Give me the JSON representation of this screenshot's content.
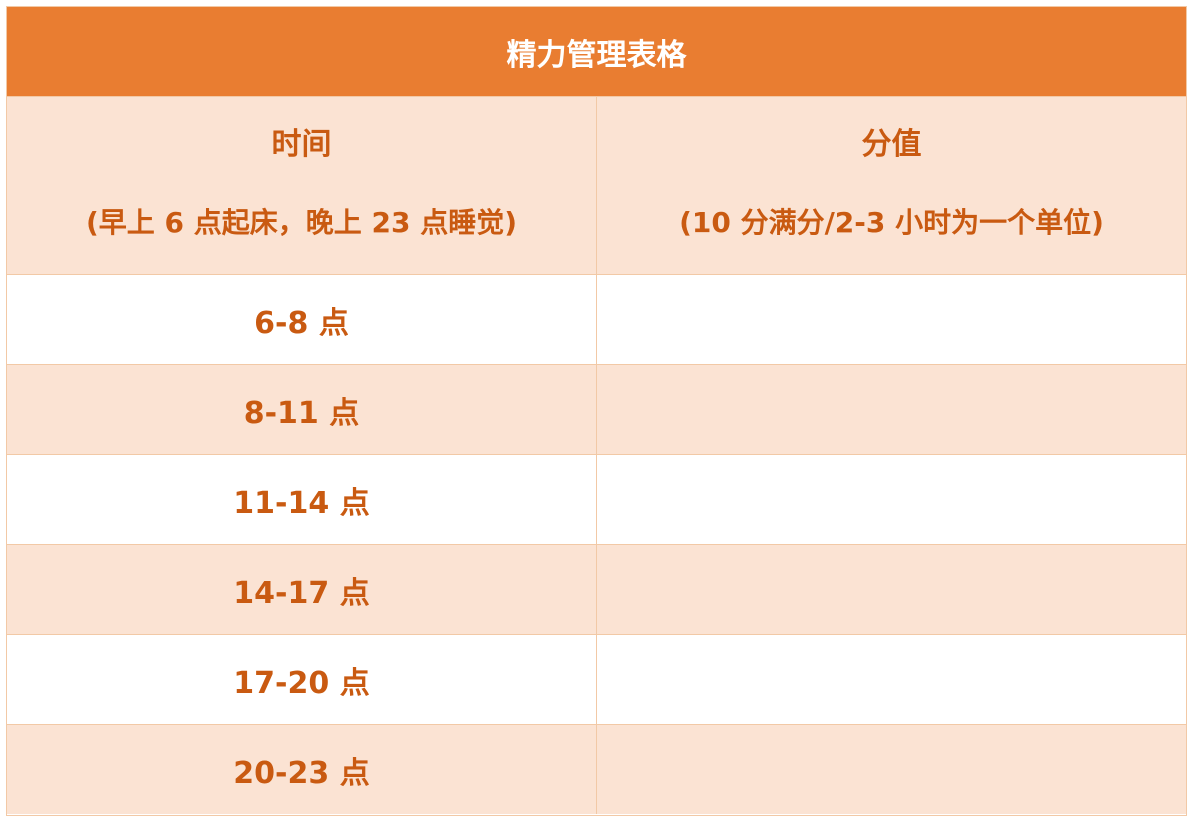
{
  "table": {
    "title": "精力管理表格",
    "header": {
      "col1_main": "时间",
      "col1_sub": "(早上 6 点起床，晚上 23 点睡觉)",
      "col2_main": "分值",
      "col2_sub": "(10 分满分/2-3 小时为一个单位)"
    },
    "rows": [
      {
        "time": "6-8 点",
        "score": ""
      },
      {
        "time": "8-11 点",
        "score": ""
      },
      {
        "time": "11-14 点",
        "score": ""
      },
      {
        "time": "14-17 点",
        "score": ""
      },
      {
        "time": "17-20 点",
        "score": ""
      },
      {
        "time": "20-23 点",
        "score": ""
      }
    ]
  },
  "colors": {
    "header_orange": "#e97d31",
    "text_orange": "#c95a11",
    "band_peach": "#fbe3d3",
    "border": "#f2c9a6"
  }
}
